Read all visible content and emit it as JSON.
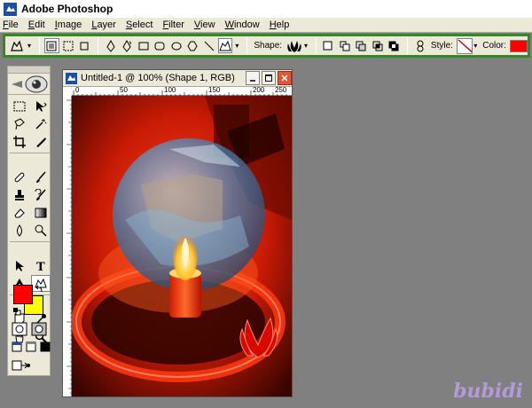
{
  "window": {
    "title": "Adobe Photoshop"
  },
  "menu": {
    "items": [
      {
        "first": "F",
        "rest": "ile"
      },
      {
        "first": "E",
        "rest": "dit"
      },
      {
        "first": "I",
        "rest": "mage"
      },
      {
        "first": "L",
        "rest": "ayer"
      },
      {
        "first": "S",
        "rest": "elect"
      },
      {
        "first": "F",
        "rest": "ilter"
      },
      {
        "first": "V",
        "rest": "iew"
      },
      {
        "first": "W",
        "rest": "indow"
      },
      {
        "first": "H",
        "rest": "elp"
      }
    ]
  },
  "options": {
    "shape_label": "Shape:",
    "style_label": "Style:",
    "color_label": "Color:",
    "color_value": "#ff0000"
  },
  "toolbox": {
    "foreground_color": "#ff0000",
    "background_color": "#ffff00"
  },
  "document": {
    "title": "Untitled-1 @ 100% (Shape 1, RGB)",
    "ruler_ticks": [
      "0",
      "50",
      "100",
      "150",
      "200",
      "250"
    ]
  },
  "watermark": "bubidi"
}
